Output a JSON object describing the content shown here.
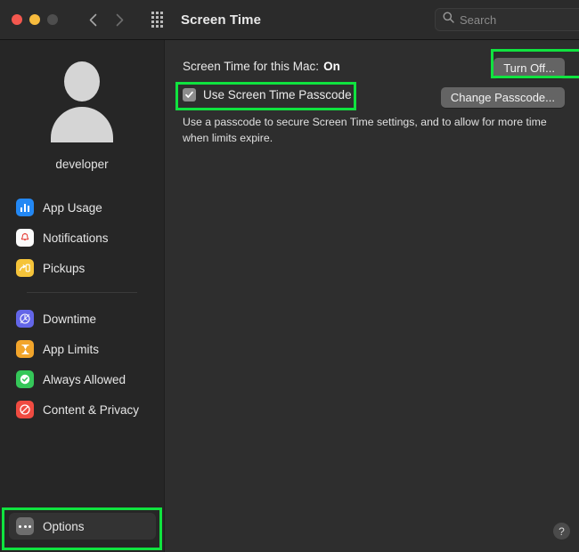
{
  "window": {
    "title": "Screen Time",
    "traffic_lights": [
      "close",
      "minimize",
      "zoom"
    ]
  },
  "toolbar": {
    "back_icon": "chevron-left-icon",
    "forward_icon": "chevron-right-icon",
    "grid_icon": "app-grid-icon",
    "search": {
      "placeholder": "Search",
      "value": "",
      "icon": "search-icon"
    }
  },
  "sidebar": {
    "avatar_icon": "user-avatar-icon",
    "username": "developer",
    "groups": [
      {
        "items": [
          {
            "label": "App Usage",
            "icon": "bar-chart-icon",
            "selected": false
          },
          {
            "label": "Notifications",
            "icon": "bell-icon",
            "selected": false
          },
          {
            "label": "Pickups",
            "icon": "phone-pickup-icon",
            "selected": false
          }
        ]
      },
      {
        "items": [
          {
            "label": "Downtime",
            "icon": "clock-icon",
            "selected": false
          },
          {
            "label": "App Limits",
            "icon": "hourglass-icon",
            "selected": false
          },
          {
            "label": "Always Allowed",
            "icon": "checkmark-icon",
            "selected": false
          },
          {
            "label": "Content & Privacy",
            "icon": "no-entry-icon",
            "selected": false
          }
        ]
      }
    ],
    "options": {
      "label": "Options",
      "icon": "ellipsis-icon",
      "selected": true
    }
  },
  "main": {
    "status_label": "Screen Time for this Mac:",
    "status_value": "On",
    "turn_off_button": "Turn Off...",
    "passcode_checkbox_label": "Use Screen Time Passcode",
    "passcode_checkbox_checked": true,
    "change_passcode_button": "Change Passcode...",
    "description": "Use a passcode to secure Screen Time settings, and to allow for more time when limits expire.",
    "help_button": "?"
  },
  "annotations": {
    "highlight_color": "#10e33f",
    "highlighted": [
      "Turn Off...",
      "Use Screen Time Passcode",
      "Options"
    ]
  }
}
